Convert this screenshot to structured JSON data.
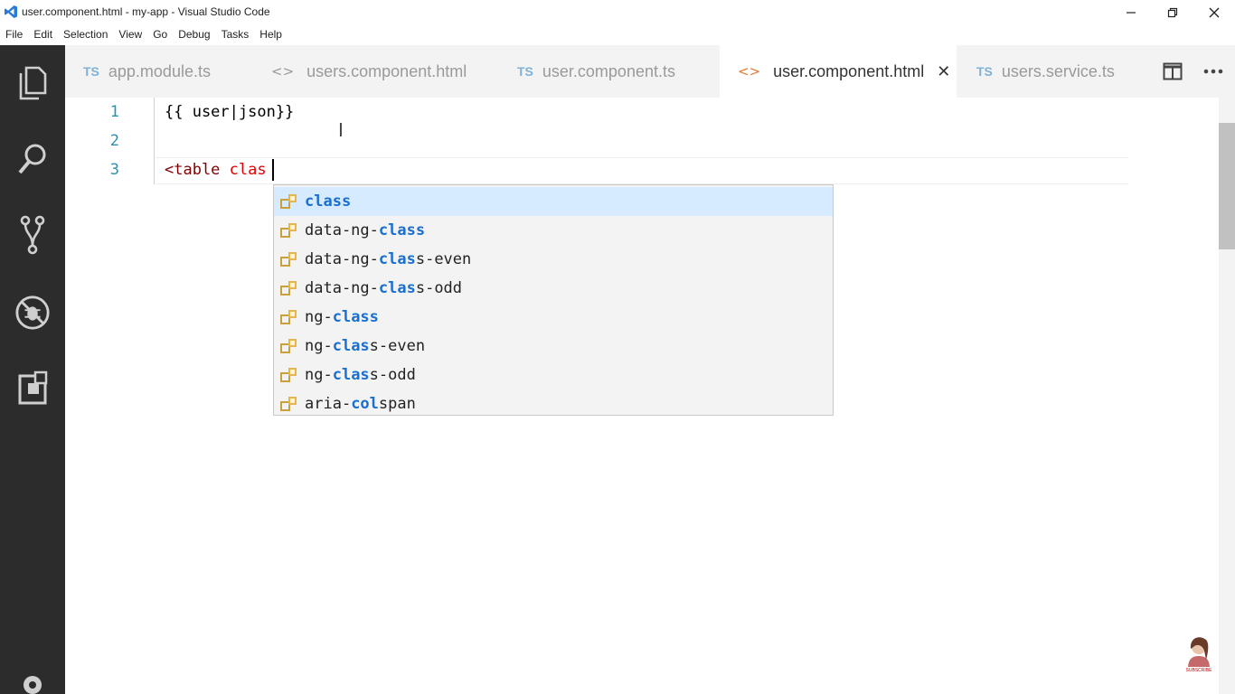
{
  "window": {
    "title": "user.component.html - my-app - Visual Studio Code"
  },
  "menu": [
    "File",
    "Edit",
    "Selection",
    "View",
    "Go",
    "Debug",
    "Tasks",
    "Help"
  ],
  "activity_icons": [
    "explorer-icon",
    "search-icon",
    "source-control-icon",
    "debug-icon",
    "extensions-icon"
  ],
  "tabs": [
    {
      "type": "TS",
      "label": "app.module.ts",
      "active": false
    },
    {
      "type": "HTML",
      "label": "users.component.html",
      "active": false
    },
    {
      "type": "TS",
      "label": "user.component.ts",
      "active": false
    },
    {
      "type": "HTML",
      "label": "user.component.html",
      "active": true
    },
    {
      "type": "TS",
      "label": "users.service.ts",
      "active": false
    }
  ],
  "tab_icons": {
    "ts": "TS",
    "html": "<>",
    "close": "✕"
  },
  "editor": {
    "line_numbers": [
      "1",
      "2",
      "3"
    ],
    "lines": {
      "l1": "{{ user|json}}",
      "l2": "",
      "l3_tag": "<table",
      "l3_attr": " clas"
    }
  },
  "suggestions": [
    {
      "pre": "",
      "match": "class",
      "post": ""
    },
    {
      "pre": "data-ng-",
      "match": "class",
      "post": ""
    },
    {
      "pre": "data-ng-",
      "match": "clas",
      "post": "s-even"
    },
    {
      "pre": "data-ng-",
      "match": "clas",
      "post": "s-odd"
    },
    {
      "pre": "ng-",
      "match": "class",
      "post": ""
    },
    {
      "pre": "ng-",
      "match": "clas",
      "post": "s-even"
    },
    {
      "pre": "ng-",
      "match": "clas",
      "post": "s-odd"
    },
    {
      "pre": "aria-",
      "match": "col",
      "post": "span",
      "extra_match": ""
    }
  ],
  "colors": {
    "activity_bar": "#2c2c2c",
    "tab_inactive_bg": "#f3f3f3",
    "suggest_selected": "#d6ebff",
    "match_highlight": "#1a6fd1",
    "line_number": "#2b91af"
  }
}
